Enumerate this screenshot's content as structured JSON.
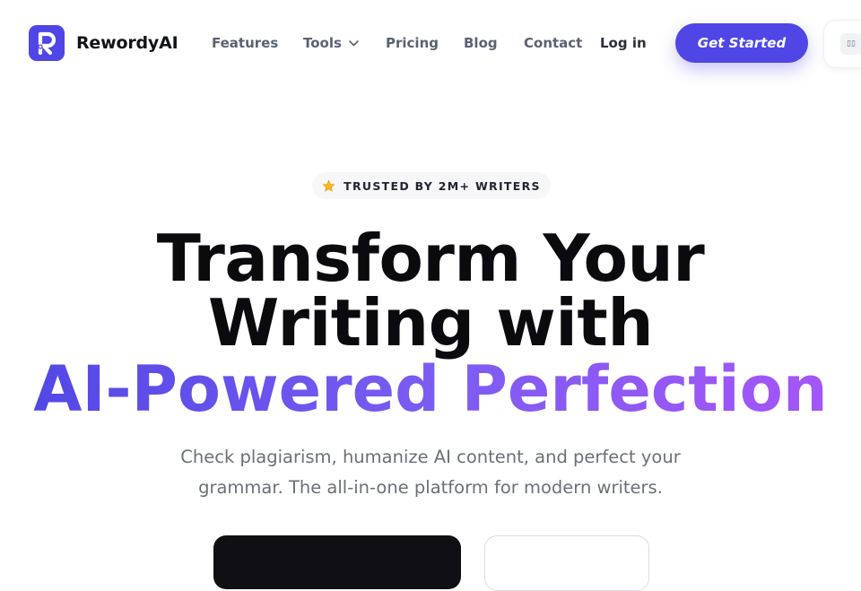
{
  "brand": {
    "name": "RewordyAI",
    "logo_icon": "letter-r-logo-icon",
    "accent": "#4f46e5"
  },
  "nav": {
    "features": "Features",
    "tools": "Tools",
    "pricing": "Pricing",
    "blog": "Blog",
    "contact": "Contact",
    "login": "Log in",
    "cta": "Get Started"
  },
  "hero": {
    "badge": "TRUSTED BY 2M+ WRITERS",
    "badge_icon": "star-icon",
    "title_line1": "Transform Your",
    "title_line2": "Writing with",
    "title_highlight": "AI-Powered Perfection",
    "subtitle": "Check plagiarism, humanize AI content, and perfect your grammar. The all-in-one platform for modern writers."
  }
}
